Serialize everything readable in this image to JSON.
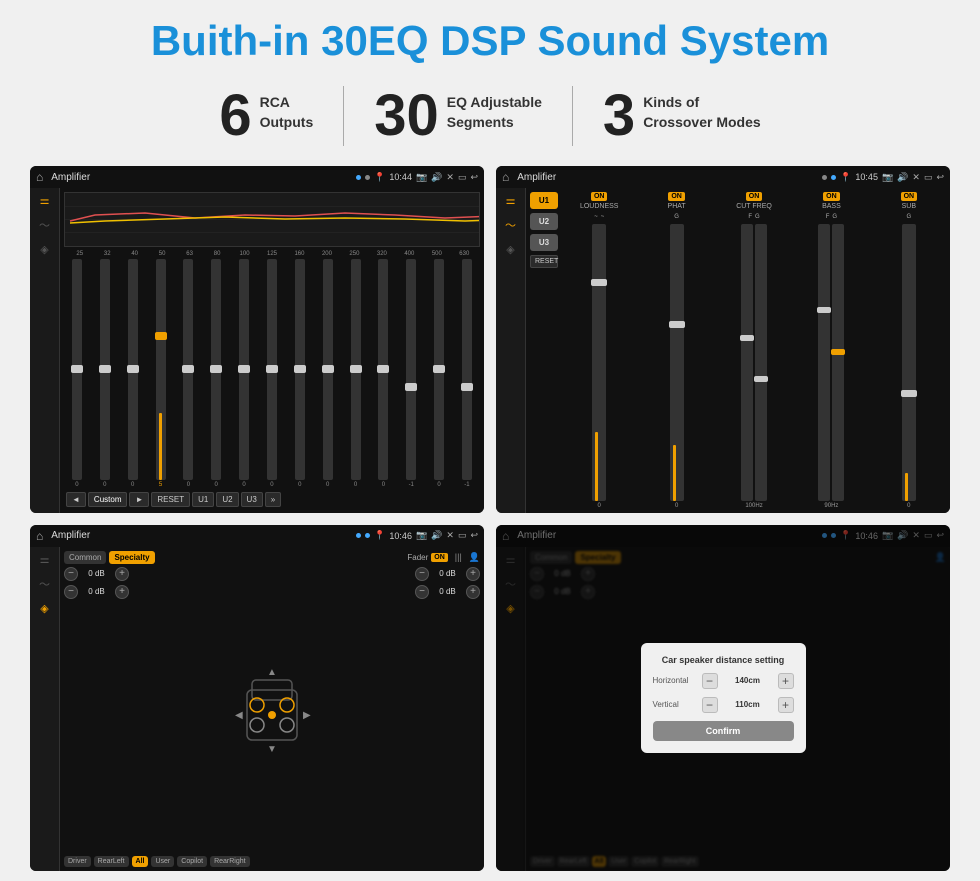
{
  "page": {
    "title": "Buith-in 30EQ DSP Sound System",
    "features": [
      {
        "number": "6",
        "line1": "RCA",
        "line2": "Outputs"
      },
      {
        "number": "30",
        "line1": "EQ Adjustable",
        "line2": "Segments"
      },
      {
        "number": "3",
        "line1": "Kinds of",
        "line2": "Crossover Modes"
      }
    ]
  },
  "screens": {
    "eq": {
      "title": "Amplifier",
      "time": "10:44",
      "freqs": [
        "25",
        "32",
        "40",
        "50",
        "63",
        "80",
        "100",
        "125",
        "160",
        "200",
        "250",
        "320",
        "400",
        "500",
        "630"
      ],
      "values": [
        "0",
        "0",
        "0",
        "5",
        "0",
        "0",
        "0",
        "0",
        "0",
        "0",
        "0",
        "0",
        "-1",
        "0",
        "-1"
      ],
      "buttons": [
        "◄",
        "Custom",
        "►",
        "RESET",
        "U1",
        "U2",
        "U3"
      ]
    },
    "crossover": {
      "title": "Amplifier",
      "time": "10:45",
      "presets": [
        "U1",
        "U2",
        "U3"
      ],
      "channels": [
        {
          "name": "LOUDNESS",
          "on": true
        },
        {
          "name": "PHAT",
          "on": true
        },
        {
          "name": "CUT FREQ",
          "on": true
        },
        {
          "name": "BASS",
          "on": true
        },
        {
          "name": "SUB",
          "on": true
        }
      ],
      "resetLabel": "RESET"
    },
    "fader": {
      "title": "Amplifier",
      "time": "10:46",
      "tabs": [
        "Common",
        "Specialty"
      ],
      "activeTab": "Specialty",
      "faderLabel": "Fader",
      "faderOn": "ON",
      "dbValues": [
        "0 dB",
        "0 dB",
        "0 dB",
        "0 dB"
      ],
      "bottomLabels": [
        "Driver",
        "RearLeft",
        "All",
        "User",
        "Copilot",
        "RearRight"
      ]
    },
    "dialog": {
      "title": "Amplifier",
      "time": "10:46",
      "tabs": [
        "Common",
        "Specialty"
      ],
      "activeTab": "Specialty",
      "dialogTitle": "Car speaker distance setting",
      "horizontal": {
        "label": "Horizontal",
        "value": "140cm"
      },
      "vertical": {
        "label": "Vertical",
        "value": "110cm"
      },
      "confirmLabel": "Confirm",
      "bottomLabels": [
        "Driver",
        "RearLeft",
        "All",
        "User",
        "Copilot",
        "RearRight"
      ],
      "dbValues": [
        "0 dB",
        "0 dB"
      ]
    }
  }
}
